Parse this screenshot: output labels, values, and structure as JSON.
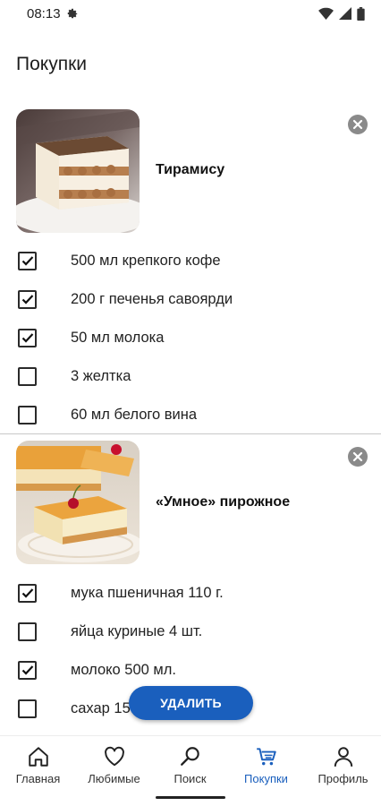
{
  "status": {
    "time": "08:13"
  },
  "page": {
    "title": "Покупки"
  },
  "recipes": [
    {
      "name": "Тирамису",
      "ingredients": [
        {
          "label": "500 мл крепкого кофе",
          "checked": true
        },
        {
          "label": "200 г печенья савоярди",
          "checked": true
        },
        {
          "label": "50 мл молока",
          "checked": true
        },
        {
          "label": "3 желтка",
          "checked": false
        },
        {
          "label": "60 мл белого вина",
          "checked": false
        }
      ]
    },
    {
      "name": "«Умное»  пирожное",
      "ingredients": [
        {
          "label": "мука пшеничная 110 г.",
          "checked": true
        },
        {
          "label": "яйца куриные 4 шт.",
          "checked": false
        },
        {
          "label": "молоко 500 мл.",
          "checked": true
        },
        {
          "label": "сахар 150 г.",
          "checked": false
        }
      ]
    }
  ],
  "actions": {
    "delete_label": "УДАЛИТЬ"
  },
  "nav": {
    "items": [
      {
        "label": "Главная",
        "icon": "home-icon"
      },
      {
        "label": "Любимые",
        "icon": "heart-icon"
      },
      {
        "label": "Поиск",
        "icon": "search-icon"
      },
      {
        "label": "Покупки",
        "icon": "cart-icon"
      },
      {
        "label": "Профиль",
        "icon": "profile-icon"
      }
    ],
    "active_index": 3
  },
  "colors": {
    "accent": "#1a5fbd",
    "remove_button": "#8a8a8a"
  }
}
